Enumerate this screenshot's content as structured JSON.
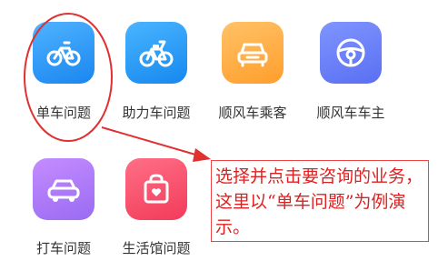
{
  "services": [
    {
      "label": "单车问题",
      "icon": "bicycle-icon",
      "color": "#2a92f5"
    },
    {
      "label": "助力车问题",
      "icon": "ebike-icon",
      "color": "#2894f4"
    },
    {
      "label": "顺风车乘客",
      "icon": "car-icon",
      "color": "#ffae40"
    },
    {
      "label": "顺风车车主",
      "icon": "steering-wheel-icon",
      "color": "#6a80f7"
    },
    {
      "label": "打车问题",
      "icon": "taxi-car-icon",
      "color": "#ab7af8"
    },
    {
      "label": "生活馆问题",
      "icon": "shopping-bag-icon",
      "color": "#f74d69"
    }
  ],
  "annotation": {
    "text": "选择并点击要咨询的业务，这里以“单车问题”为例演示。",
    "color": "#e02020"
  }
}
